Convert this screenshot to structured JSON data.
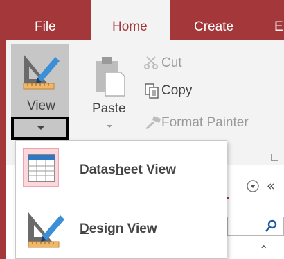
{
  "tabs": [
    "File",
    "Home",
    "Create",
    "E"
  ],
  "active_tab": "Home",
  "ribbon": {
    "view_label": "View",
    "paste_label": "Paste",
    "cut_label": "Cut",
    "copy_label": "Copy",
    "format_painter_label": "Format Painter"
  },
  "view_menu": {
    "items": [
      {
        "pre": "Datas",
        "accel": "h",
        "post": "eet View",
        "icon": "datasheet-grid-icon"
      },
      {
        "pre": "",
        "accel": "D",
        "post": "esign View",
        "icon": "design-ruler-pencil-icon"
      }
    ]
  },
  "pane": {
    "search_icon": "search-icon",
    "collapse_icon": "double-chevron-left-icon",
    "dropdown_icon": "circle-chevron-down-icon",
    "expand_icon": "double-chevron-up-icon"
  },
  "colors": {
    "accent": "#a4373a",
    "ribbon_bg": "#f3f3f3",
    "highlight": "#fcd7db"
  }
}
